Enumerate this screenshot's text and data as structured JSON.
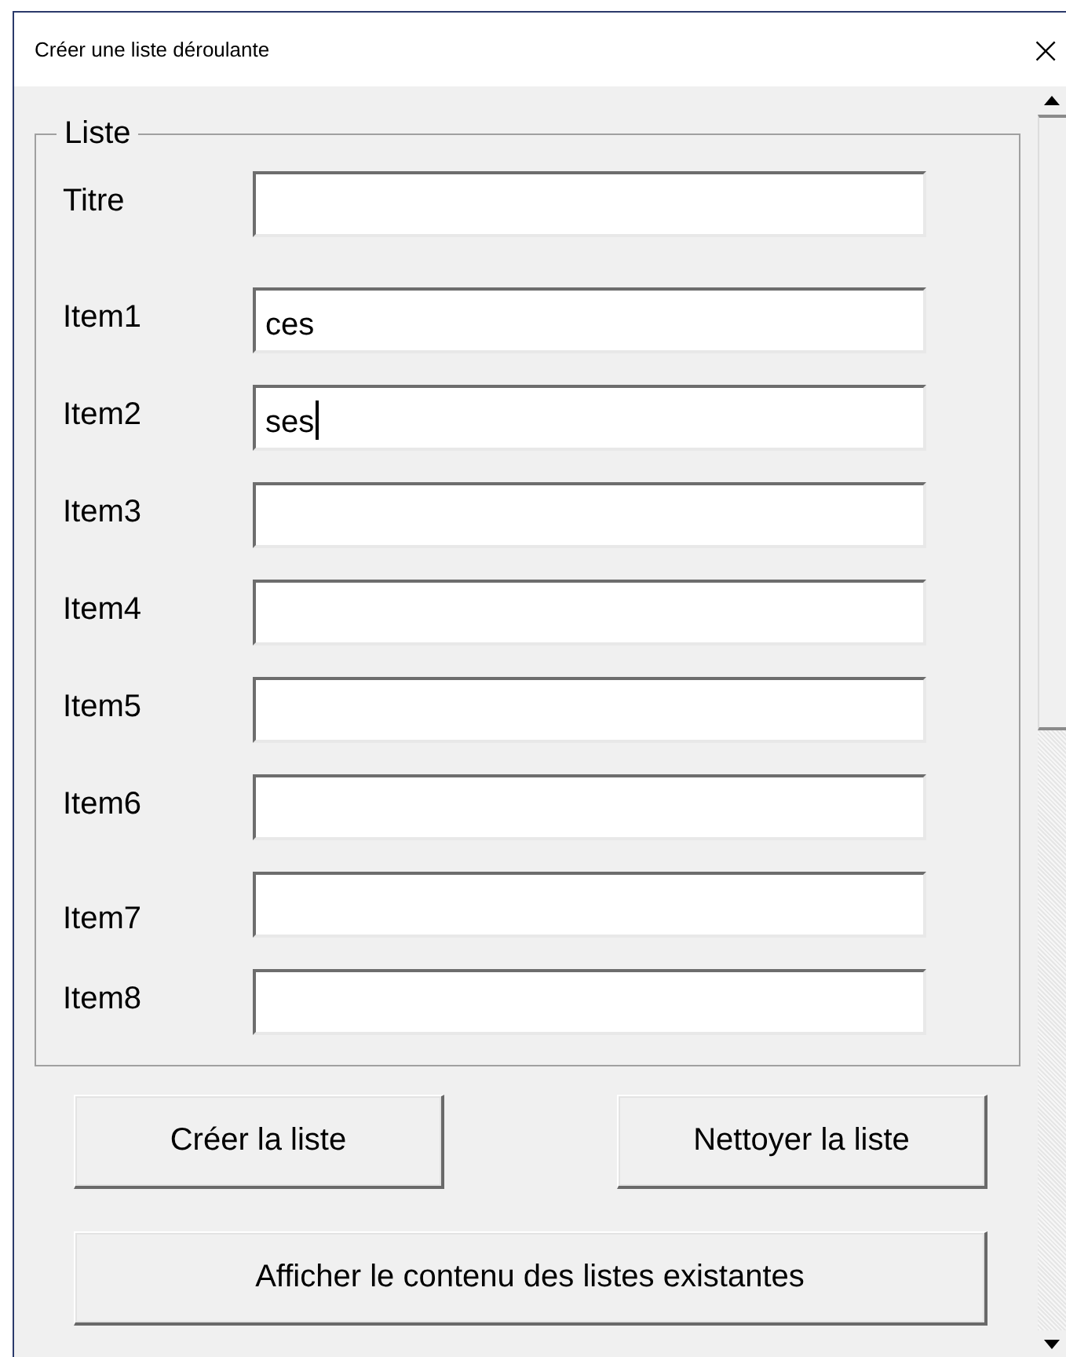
{
  "window": {
    "title": "Créer une liste déroulante",
    "close": "×"
  },
  "group": {
    "title": "Liste",
    "fields": [
      {
        "label": "Titre",
        "focused": false
      },
      {
        "label": "Item1",
        "value": "ces",
        "focused": false
      },
      {
        "label": "Item2",
        "value": "ses",
        "focused": true
      },
      {
        "label": "Item3",
        "focused": false
      },
      {
        "label": "Item4",
        "focused": false
      },
      {
        "label": "Item5",
        "focused": false
      },
      {
        "label": "Item6",
        "focused": false
      },
      {
        "label": "Item7",
        "focused": false
      },
      {
        "label": "Item8",
        "focused": false
      }
    ]
  },
  "buttons": [
    {
      "label": "Créer la liste",
      "kind": "half"
    },
    {
      "label": "Nettoyer la liste",
      "kind": "half"
    },
    {
      "label": "Afficher le contenu des listes existantes",
      "kind": "wide"
    }
  ]
}
